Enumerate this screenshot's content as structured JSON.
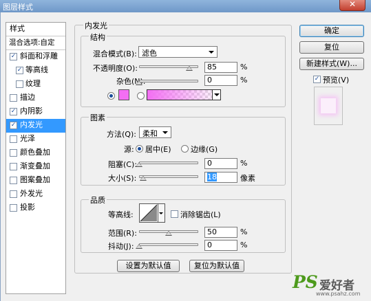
{
  "window": {
    "title": "图层样式"
  },
  "sidebar": {
    "header": "样式",
    "blend_options": "混合选项:自定",
    "items": [
      {
        "label": "斜面和浮雕",
        "checked": true,
        "sub": false,
        "selected": false
      },
      {
        "label": "等高线",
        "checked": true,
        "sub": true,
        "selected": false
      },
      {
        "label": "纹理",
        "checked": false,
        "sub": true,
        "selected": false
      },
      {
        "label": "描边",
        "checked": false,
        "sub": false,
        "selected": false
      },
      {
        "label": "内阴影",
        "checked": true,
        "sub": false,
        "selected": false
      },
      {
        "label": "内发光",
        "checked": true,
        "sub": false,
        "selected": true
      },
      {
        "label": "光泽",
        "checked": false,
        "sub": false,
        "selected": false
      },
      {
        "label": "颜色叠加",
        "checked": false,
        "sub": false,
        "selected": false
      },
      {
        "label": "渐变叠加",
        "checked": false,
        "sub": false,
        "selected": false
      },
      {
        "label": "图案叠加",
        "checked": false,
        "sub": false,
        "selected": false
      },
      {
        "label": "外发光",
        "checked": false,
        "sub": false,
        "selected": false
      },
      {
        "label": "投影",
        "checked": false,
        "sub": false,
        "selected": false
      }
    ]
  },
  "buttons": {
    "ok": "确定",
    "reset": "复位",
    "new_style": "新建样式(W)...",
    "preview": "预览(V)"
  },
  "panel": {
    "title": "内发光",
    "structure": {
      "title": "结构",
      "blend_mode_label": "混合模式(B):",
      "blend_mode_value": "滤色",
      "opacity_label": "不透明度(O):",
      "opacity_value": "85",
      "opacity_level": 0.85,
      "noise_label": "杂色(N):",
      "noise_value": "0",
      "noise_level": 0,
      "percent": "%",
      "glow_color": "#f36ef3"
    },
    "elements": {
      "title": "图素",
      "method_label": "方法(Q):",
      "method_value": "柔和",
      "source_label": "源:",
      "source_center": "居中(E)",
      "source_edge": "边缘(G)",
      "choke_label": "阻塞(C):",
      "choke_value": "0",
      "choke_level": 0,
      "size_label": "大小(S):",
      "size_value": "18",
      "size_level": 0.072,
      "size_unit": "像素"
    },
    "quality": {
      "title": "品质",
      "contour_label": "等高线:",
      "antialias_label": "消除锯齿(L)",
      "range_label": "范围(R):",
      "range_value": "50",
      "range_level": 0.5,
      "jitter_label": "抖动(J):",
      "jitter_value": "0",
      "jitter_level": 0
    },
    "set_default": "设置为默认值",
    "reset_default": "复位为默认值"
  },
  "watermark": {
    "brand": "PS",
    "text": "爱好者",
    "url": "www.psahz.com"
  }
}
